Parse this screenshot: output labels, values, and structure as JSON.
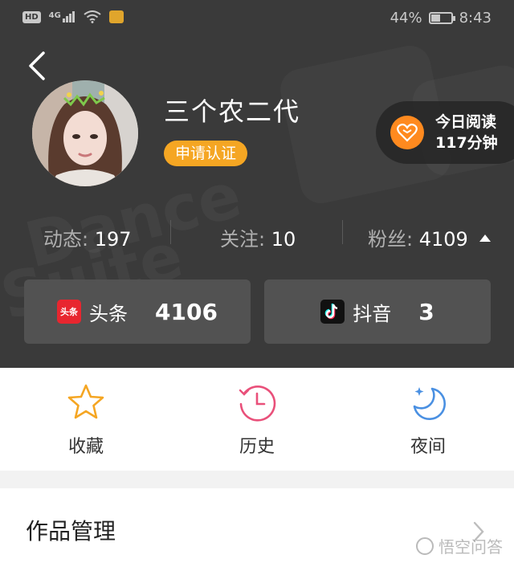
{
  "status_bar": {
    "hd": "HD",
    "network": "4G",
    "battery": "44%",
    "battery_level": 0.44,
    "time": "8:43"
  },
  "profile": {
    "name": "三个农二代",
    "verify_label": "申请认证"
  },
  "reading": {
    "line1": "今日阅读",
    "line2": "117分钟"
  },
  "stats": {
    "posts": {
      "label": "动态: ",
      "value": "197"
    },
    "following": {
      "label": "关注: ",
      "value": "10"
    },
    "fans": {
      "label": "粉丝: ",
      "value": "4109"
    }
  },
  "platforms": [
    {
      "icon_text": "头条",
      "label": "头条",
      "value": "4106",
      "icon": "toutiao-icon",
      "color": "#e8262f"
    },
    {
      "icon_text": "",
      "label": "抖音",
      "value": "3",
      "icon": "douyin-icon",
      "color": "#111111"
    }
  ],
  "quick_actions": [
    {
      "label": "收藏",
      "icon": "star-icon",
      "color": "#f5a623"
    },
    {
      "label": "历史",
      "icon": "history-clock-icon",
      "color": "#e9507a"
    },
    {
      "label": "夜间",
      "icon": "moon-icon",
      "color": "#4a90e2"
    }
  ],
  "menu": {
    "works_label": "作品管理"
  },
  "watermark": {
    "text": "悟空问答"
  },
  "colors": {
    "header_bg": "#3a3a3a",
    "accent_orange": "#f5a623",
    "card_bg": "#525252"
  }
}
